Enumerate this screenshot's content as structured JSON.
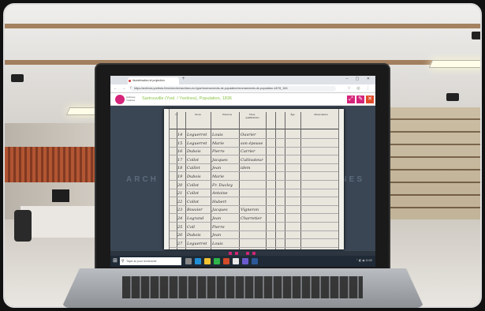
{
  "browser": {
    "tab_title": "Numérisation et projection",
    "url": "https://archives.yvelines.fr/rechercher/archives-en-ligne/recensements-de-population/recensements-de-population-AD78_1M1",
    "nav_glyphs": "← → ⟳",
    "extension_glyphs": "☆ ◎ ⋮"
  },
  "app": {
    "logo_text": "Archives Yvelines",
    "document_title": "Sartrouville (Yvel. / Yvelines), Population, 1836",
    "tools": [
      "⤢",
      "✎",
      "✕"
    ]
  },
  "viewer": {
    "watermark_left": "ARCH",
    "watermark_right": "VELINES",
    "register": {
      "headers": [
        "N°",
        "Noms",
        "Prénoms",
        "Titres, qualifications",
        "Âge",
        "Observations"
      ],
      "rows": [
        [
          "14",
          "Leguerret",
          "Louis",
          "Ouvrier"
        ],
        [
          "15",
          "Leguerret",
          "Marie",
          "son épouse"
        ],
        [
          "16",
          "Dubois",
          "Pierre",
          "Carrier"
        ],
        [
          "17",
          "Collot",
          "Jacques",
          "Cultivateur"
        ],
        [
          "18",
          "Caillet",
          "Jean",
          "idem"
        ],
        [
          "19",
          "Dubois",
          "Marie",
          ""
        ],
        [
          "20",
          "Collot",
          "Fr. Ducloy",
          ""
        ],
        [
          "21",
          "Collot",
          "Antoine",
          ""
        ],
        [
          "22",
          "Collot",
          "Hubert",
          ""
        ],
        [
          "23",
          "Bouvier",
          "Jacques",
          "Vigneron"
        ],
        [
          "24",
          "Legrand",
          "Jean",
          "Charretier"
        ],
        [
          "25",
          "Coll",
          "Pierre",
          ""
        ],
        [
          "26",
          "Dubois",
          "Jean",
          ""
        ],
        [
          "27",
          "Leguerret",
          "Louis",
          ""
        ]
      ]
    }
  },
  "taskbar": {
    "search_placeholder": "Taper ici pour rechercher",
    "tray_text": "⌃ ◧ ◉ 11:02"
  },
  "colors": {
    "accent": "#d6247a",
    "title_green": "#8bc34a",
    "viewer_bg": "#3b4654"
  }
}
